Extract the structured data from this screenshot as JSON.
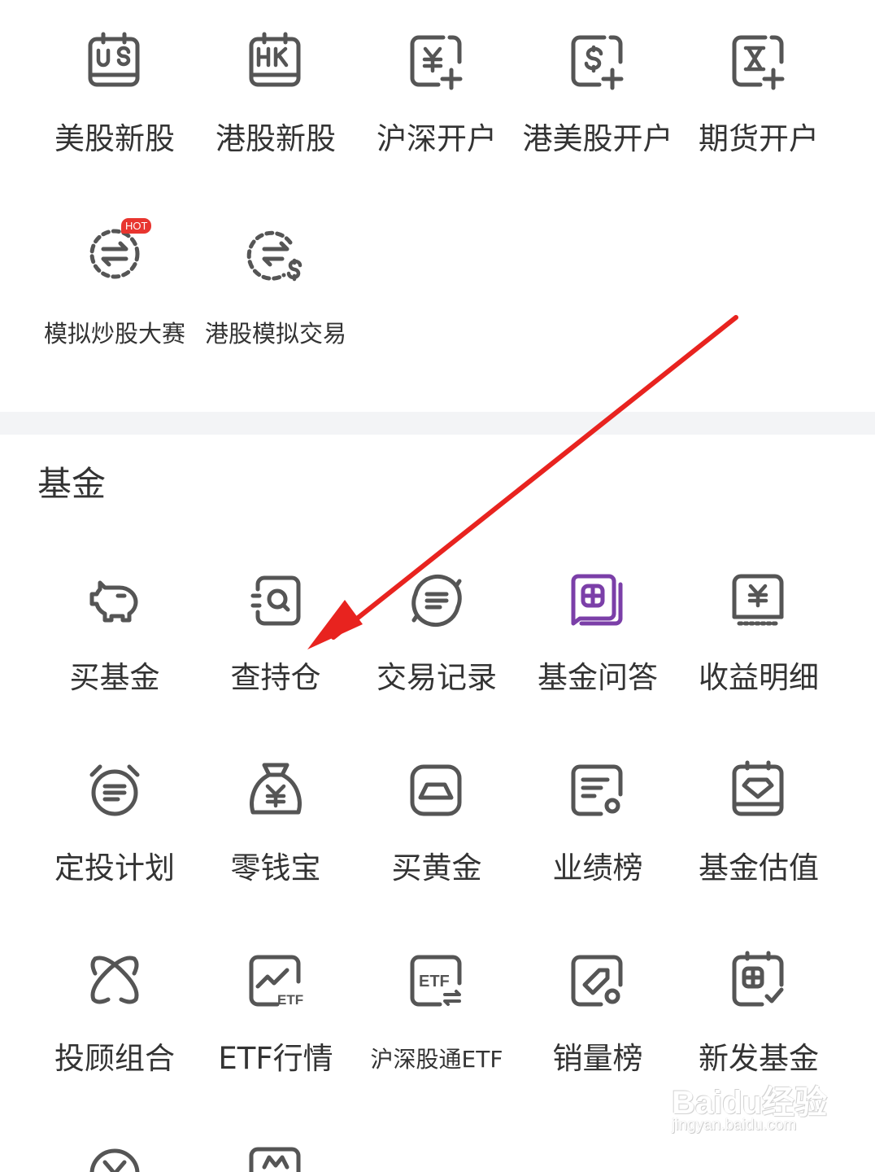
{
  "stock_tools": {
    "row1": [
      {
        "label": "美股新股",
        "icon": "us-calendar-icon"
      },
      {
        "label": "港股新股",
        "icon": "hk-calendar-icon"
      },
      {
        "label": "沪深开户",
        "icon": "yuan-account-add-icon"
      },
      {
        "label": "港美股开户",
        "icon": "dollar-account-add-icon"
      },
      {
        "label": "期货开户",
        "icon": "hourglass-account-add-icon"
      }
    ],
    "row2": [
      {
        "label": "模拟炒股大赛",
        "icon": "exchange-circle-icon",
        "badge": "HOT"
      },
      {
        "label": "港股模拟交易",
        "icon": "exchange-dollar-icon"
      }
    ]
  },
  "fund_section": {
    "title": "基金",
    "row1": [
      {
        "label": "买基金",
        "icon": "piggy-bank-icon"
      },
      {
        "label": "查持仓",
        "icon": "search-holdings-icon"
      },
      {
        "label": "交易记录",
        "icon": "record-refresh-icon"
      },
      {
        "label": "基金问答",
        "icon": "fund-qa-icon",
        "accent": "#7b3fa8"
      },
      {
        "label": "收益明细",
        "icon": "yuan-receipt-icon"
      }
    ],
    "row2": [
      {
        "label": "定投计划",
        "icon": "alarm-clock-icon"
      },
      {
        "label": "零钱宝",
        "icon": "money-bag-icon"
      },
      {
        "label": "买黄金",
        "icon": "gold-bar-icon"
      },
      {
        "label": "业绩榜",
        "icon": "ranking-list-icon"
      },
      {
        "label": "基金估值",
        "icon": "valuation-diamond-icon"
      }
    ],
    "row3": [
      {
        "label": "投顾组合",
        "icon": "advisor-combo-icon"
      },
      {
        "label": "ETF行情",
        "icon": "etf-chart-icon"
      },
      {
        "label": "沪深股通ETF",
        "icon": "etf-exchange-icon"
      },
      {
        "label": "销量榜",
        "icon": "sales-tag-icon"
      },
      {
        "label": "新发基金",
        "icon": "new-fund-check-icon"
      }
    ]
  },
  "colors": {
    "icon_stroke": "#555555",
    "text": "#333333",
    "hot_badge": "#e8352f",
    "annotation_arrow": "#e8231f",
    "fund_qa_accent": "#7b3fa8",
    "divider": "#f3f4f6"
  },
  "watermark": {
    "main": "Baidu经验",
    "sub": "jingyan.baidu.com"
  }
}
